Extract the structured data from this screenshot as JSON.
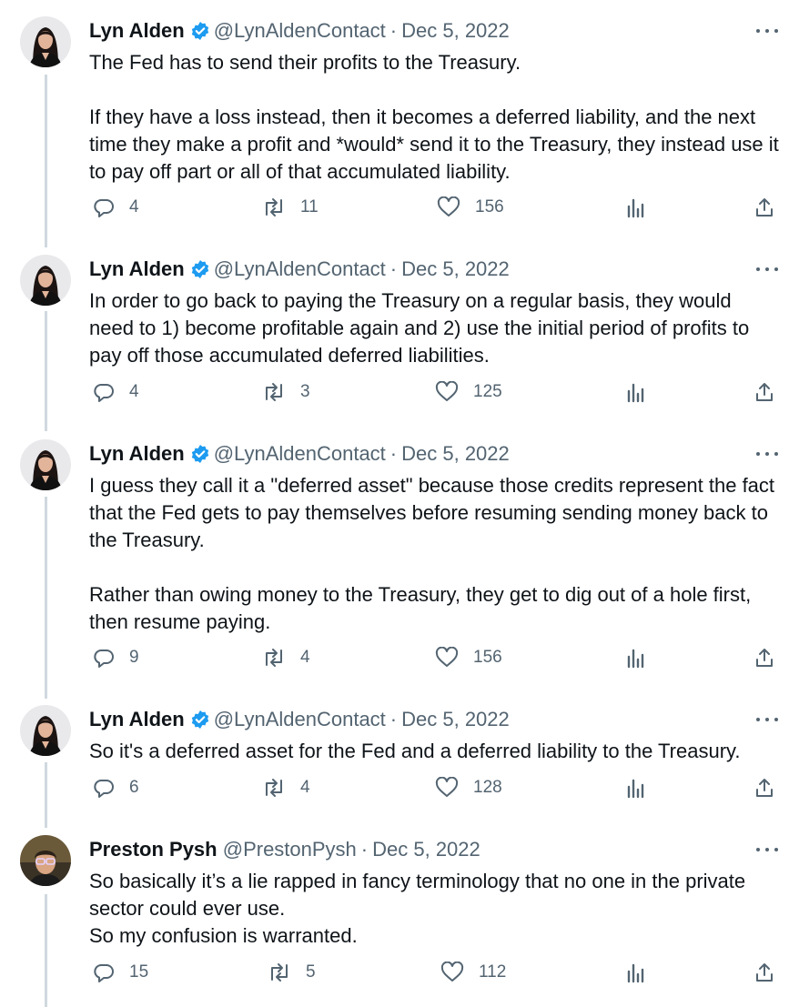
{
  "tweets": [
    {
      "name": "Lyn Alden",
      "handle": "@LynAldenContact",
      "date": "Dec 5, 2022",
      "verified": true,
      "avatar": "woman-dark-hair-avatar",
      "text": "The Fed has to send their profits to the Treasury.\n\nIf they have a loss instead, then it becomes a deferred liability, and the next time they make a profit and *would* send it to the Treasury, they instead use it to pay off part or all of that accumulated liability.",
      "replies": "4",
      "retweets": "11",
      "likes": "156"
    },
    {
      "name": "Lyn Alden",
      "handle": "@LynAldenContact",
      "date": "Dec 5, 2022",
      "verified": true,
      "avatar": "woman-dark-hair-avatar",
      "text": "In order to go back to paying the Treasury on a regular basis, they would need to 1) become profitable again and 2) use the initial period of profits to pay off those accumulated deferred liabilities.",
      "replies": "4",
      "retweets": "3",
      "likes": "125"
    },
    {
      "name": "Lyn Alden",
      "handle": "@LynAldenContact",
      "date": "Dec 5, 2022",
      "verified": true,
      "avatar": "woman-dark-hair-avatar",
      "text": "I guess they call it a \"deferred asset\" because those credits represent the fact that the Fed gets to pay themselves before resuming sending money back to the Treasury.\n\nRather than owing money to the Treasury, they get to dig out of a hole first, then resume paying.",
      "replies": "9",
      "retweets": "4",
      "likes": "156"
    },
    {
      "name": "Lyn Alden",
      "handle": "@LynAldenContact",
      "date": "Dec 5, 2022",
      "verified": true,
      "avatar": "woman-dark-hair-avatar",
      "text": "So it's a deferred asset for the Fed and a deferred liability to the Treasury.",
      "replies": "6",
      "retweets": "4",
      "likes": "128"
    },
    {
      "name": "Preston Pysh",
      "handle": "@PrestonPysh",
      "date": "Dec 5, 2022",
      "verified": false,
      "avatar": "man-glasses-avatar",
      "text": "So basically it’s a lie rapped in fancy terminology that no one in the private sector could ever use.\nSo my confusion is warranted.",
      "replies": "15",
      "retweets": "5",
      "likes": "112"
    }
  ],
  "separator": "·",
  "icons": {
    "reply": "reply-icon",
    "retweet": "retweet-icon",
    "like": "heart-icon",
    "views": "views-icon",
    "share": "share-icon",
    "more": "more-icon",
    "verified": "verified-badge-icon"
  },
  "colors": {
    "text": "#0f1419",
    "secondary": "#536471",
    "verified": "#1d9bf0",
    "thread_line": "#cfd9de"
  }
}
